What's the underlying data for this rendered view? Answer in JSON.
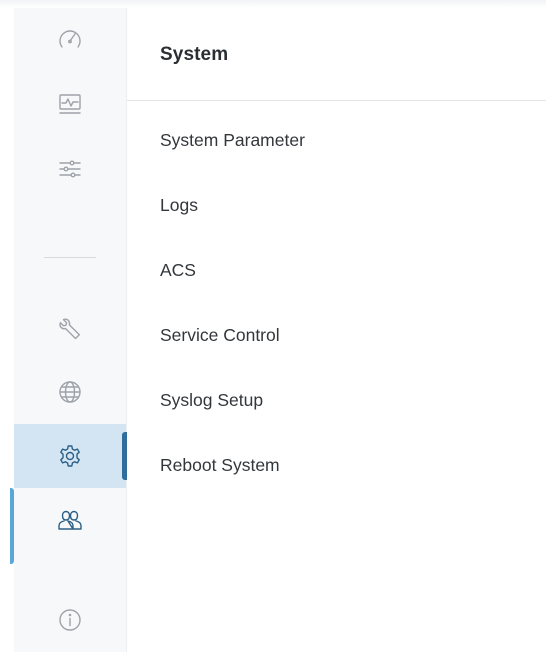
{
  "sidebar": {
    "items": [
      {
        "icon": "dashboard-gauge-icon",
        "state": "normal"
      },
      {
        "icon": "monitoring-pulse-icon",
        "state": "normal"
      },
      {
        "icon": "settings-sliders-icon",
        "state": "normal"
      },
      {
        "icon": "wrench-icon",
        "state": "normal"
      },
      {
        "icon": "globe-icon",
        "state": "normal"
      },
      {
        "icon": "gear-icon",
        "state": "active"
      },
      {
        "icon": "users-icon",
        "state": "hover"
      },
      {
        "icon": "info-icon",
        "state": "normal"
      }
    ],
    "colors": {
      "icon": "#9ea3a9",
      "active_icon": "#2c5f86",
      "active_background": "#d3e5f3",
      "active_indicator": "#2f6d9c",
      "hover_indicator": "#5aa6d8"
    }
  },
  "panel": {
    "title": "System",
    "menu": [
      "System Parameter",
      "Logs",
      "ACS",
      "Service Control",
      "Syslog Setup",
      "Reboot System"
    ]
  }
}
